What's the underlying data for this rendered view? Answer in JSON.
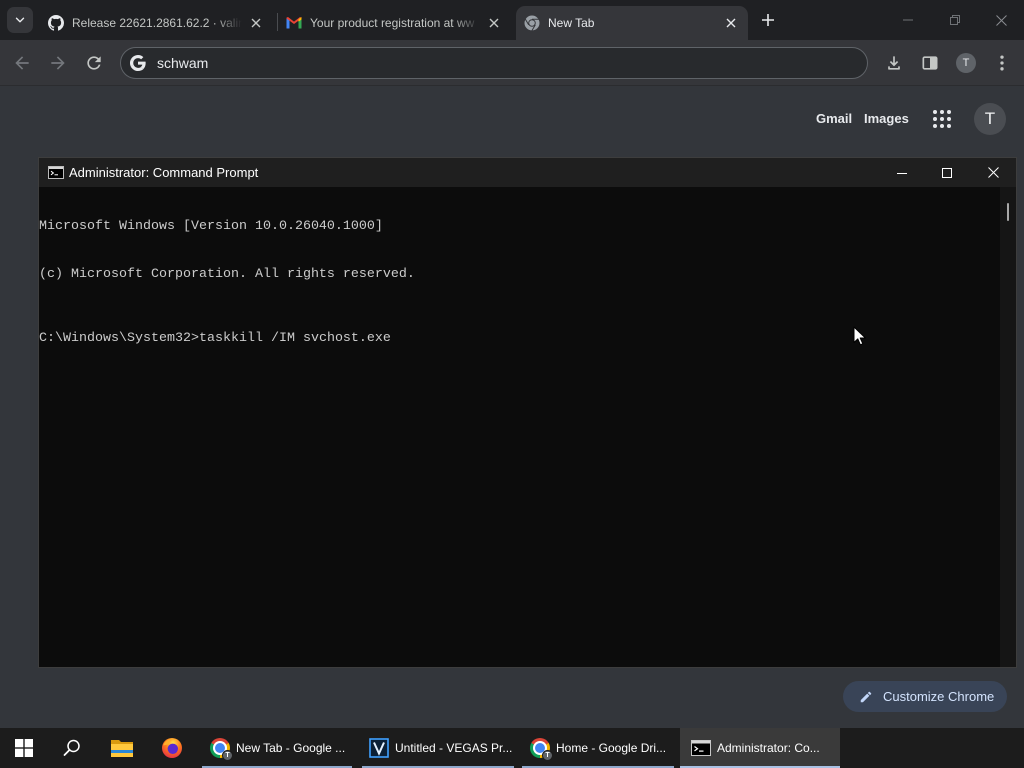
{
  "browser": {
    "tabs": [
      {
        "title": "Release 22621.2861.62.2 · valin",
        "icon": "github-icon",
        "active": false
      },
      {
        "title": "Your product registration at ww",
        "icon": "gmail-icon",
        "active": false
      },
      {
        "title": "New Tab",
        "icon": "chrome-icon",
        "active": true
      }
    ],
    "omnibox": {
      "value": "schwam",
      "icon": "google-g-icon"
    },
    "profile_initial": "T"
  },
  "new_tab_page": {
    "links": {
      "gmail": "Gmail",
      "images": "Images"
    },
    "avatar_initial": "T",
    "customize_label": "Customize Chrome"
  },
  "cmd_window": {
    "title": "Administrator: Command Prompt",
    "output": [
      "Microsoft Windows [Version 10.0.26040.1000]",
      "(c) Microsoft Corporation. All rights reserved."
    ],
    "prompt": "C:\\Windows\\System32>",
    "command": "taskkill /IM svchost.exe"
  },
  "taskbar": {
    "pinned": [
      {
        "icon": "windows-start-icon"
      },
      {
        "icon": "search-icon"
      },
      {
        "icon": "file-explorer-icon"
      },
      {
        "icon": "firefox-icon"
      }
    ],
    "windows": [
      {
        "label": "New Tab - Google ...",
        "icon": "chrome-icon",
        "active": false
      },
      {
        "label": "Untitled - VEGAS Pr...",
        "icon": "vegas-icon",
        "active": false
      },
      {
        "label": "Home - Google Dri...",
        "icon": "chrome-icon",
        "active": false
      },
      {
        "label": "Administrator: Co...",
        "icon": "cmd-icon",
        "active": true
      }
    ]
  },
  "colors": {
    "tab_strip": "#1f2023",
    "toolbar": "#35363a",
    "console_background": "#0c0c0c",
    "console_text": "#cccccc",
    "taskbar": "#1c1c1c",
    "taskbar_active": "#3a3a3a"
  }
}
